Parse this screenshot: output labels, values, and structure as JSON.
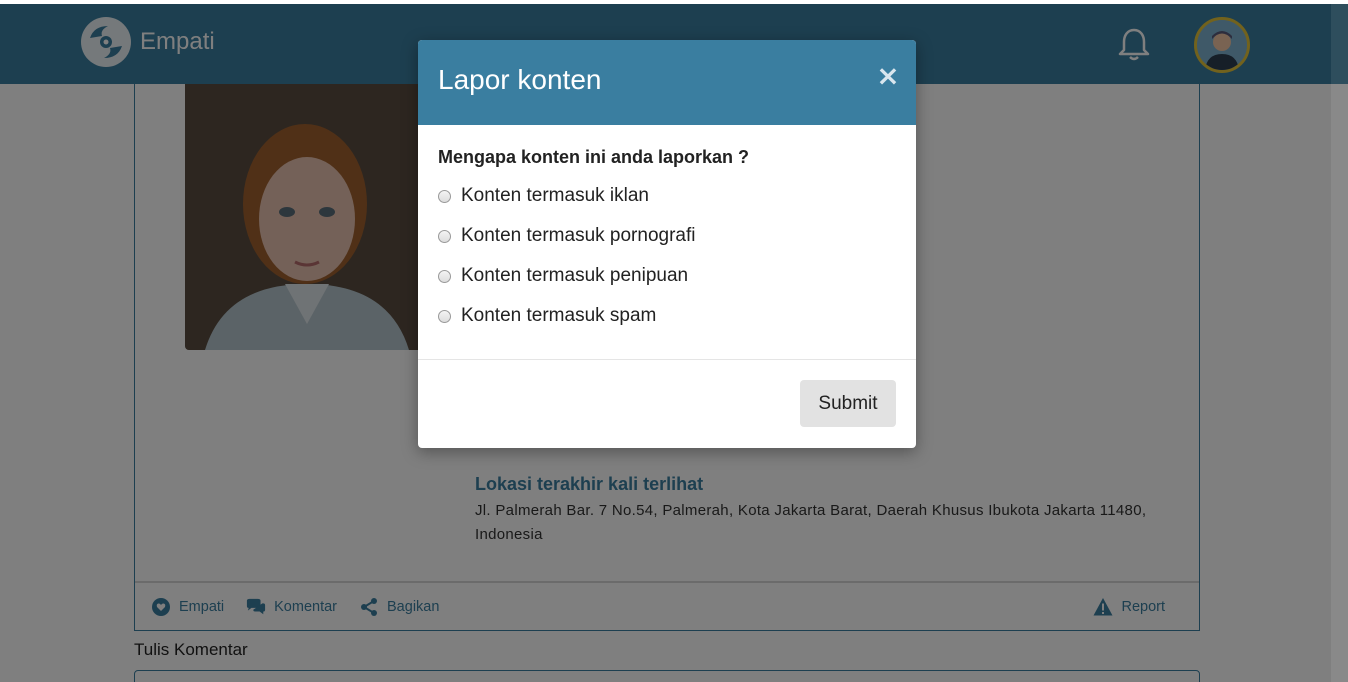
{
  "navbar": {
    "brand_name": "Empati",
    "logo_icon": "hands-heart-logo",
    "bell_icon": "bell-icon",
    "avatar_icon": "user-avatar"
  },
  "post": {
    "location_title": "Lokasi terakhir kali terlihat",
    "location_address": "Jl. Palmerah Bar. 7 No.54, Palmerah, Kota Jakarta Barat, Daerah Khusus Ibukota Jakarta 11480, Indonesia"
  },
  "actions": {
    "empati": "Empati",
    "komentar": "Komentar",
    "bagikan": "Bagikan",
    "report": "Report"
  },
  "comment": {
    "label": "Tulis Komentar"
  },
  "modal": {
    "title": "Lapor konten",
    "close": "×",
    "question": "Mengapa konten ini anda laporkan ?",
    "options": [
      {
        "label": "Konten termasuk iklan"
      },
      {
        "label": "Konten termasuk pornografi"
      },
      {
        "label": "Konten termasuk penipuan"
      },
      {
        "label": "Konten termasuk spam"
      }
    ],
    "submit_label": "Submit"
  },
  "colors": {
    "primary": "#3a7ea0",
    "avatar_ring": "#e5c53a",
    "submit_bg": "#e2e2e2"
  }
}
